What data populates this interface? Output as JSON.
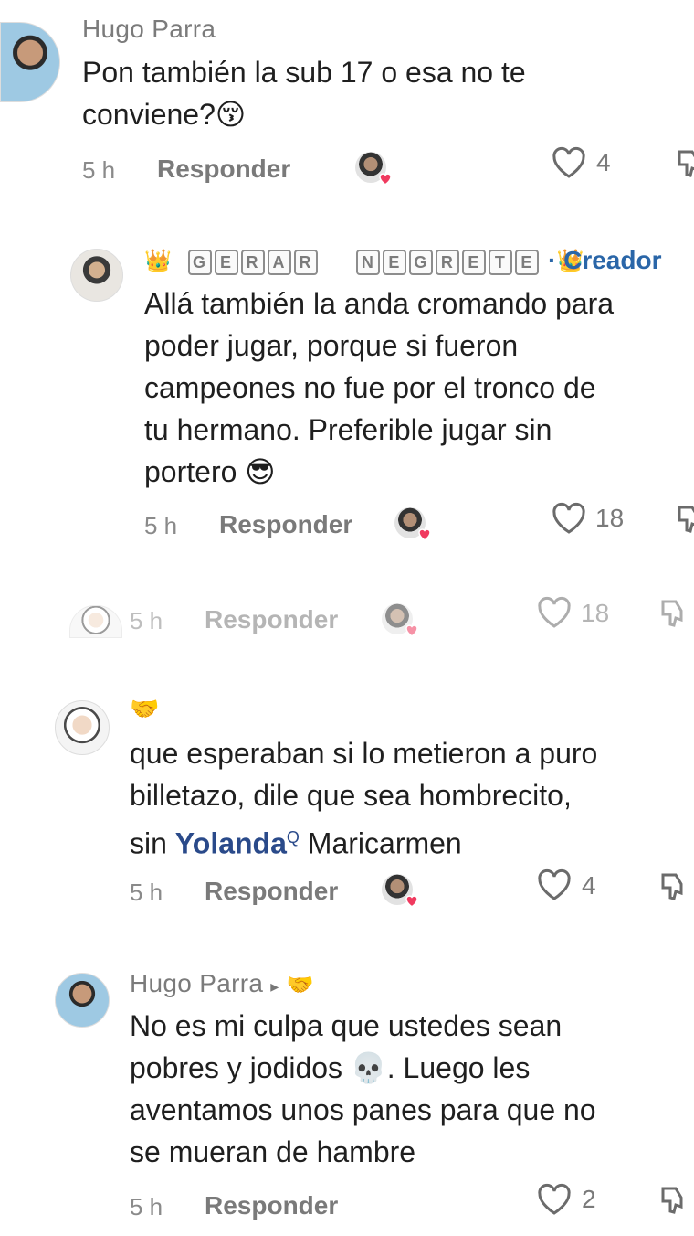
{
  "comments": [
    {
      "username": "Hugo Parra",
      "text_line1": "Pon también la sub 17 o esa no te",
      "text_line2": "conviene?",
      "emoji": "😚",
      "time": "5 h",
      "reply_label": "Responder",
      "likes": "4"
    },
    {
      "creator_name_letters_1": [
        "G",
        "E",
        "R",
        "A",
        "R"
      ],
      "creator_name_letters_2": [
        "N",
        "E",
        "G",
        "R",
        "E",
        "T",
        "E"
      ],
      "crown_left": "👑",
      "crown_right": "👑",
      "creator_tag": "· Creador",
      "text_lines": [
        "Allá también la anda cromando para",
        "poder jugar, porque si fueron",
        "campeones no fue por el tronco de",
        "tu hermano. Preferible jugar sin",
        "portero"
      ],
      "emoji": "😎",
      "time": "5 h",
      "reply_label": "Responder",
      "likes": "18"
    },
    {
      "time": "5 h",
      "reply_label": "Responder",
      "likes": "18"
    },
    {
      "username_emoji": "🤝",
      "text_line1": "que esperaban si lo metieron a puro",
      "text_line2": "billetazo, dile que sea hombrecito,",
      "text_line3_pre": "sin ",
      "mention": "Yolanda",
      "mention_mark": "Q",
      "text_line3_post": " Maricarmen",
      "time": "5 h",
      "reply_label": "Responder",
      "likes": "4"
    },
    {
      "username": "Hugo Parra",
      "reply_arrow": "▸",
      "reply_to_emoji": "🤝",
      "text_line1": "No es mi culpa que ustedes sean",
      "text_line2_pre": "pobres y jodidos ",
      "emoji": "💀",
      "text_line2_post": ". Luego les",
      "text_line3": "aventamos unos panes para que no",
      "text_line4": "se mueran de hambre",
      "time": "5 h",
      "reply_label": "Responder",
      "likes": "2"
    }
  ],
  "colors": {
    "creator_tag": "#2a66a8",
    "mention": "#2a4a8a",
    "heart": "#f03a5f"
  }
}
